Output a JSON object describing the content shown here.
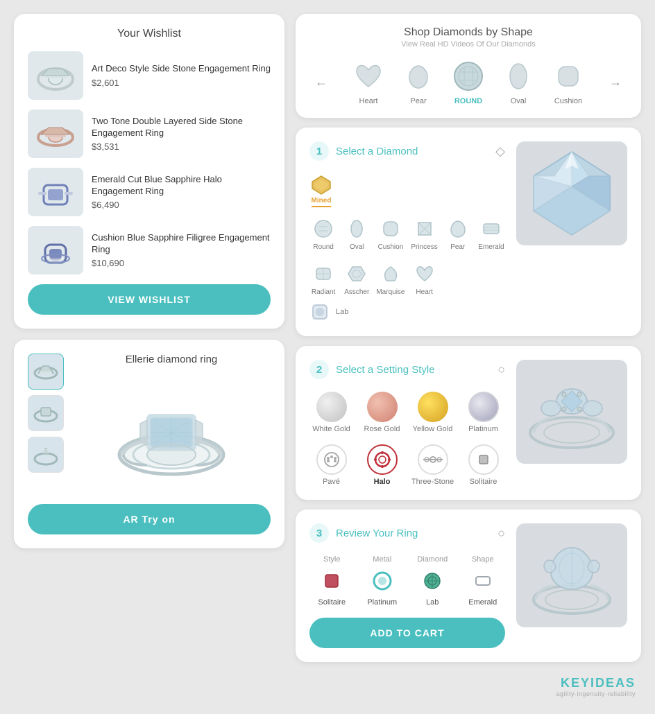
{
  "wishlist": {
    "title": "Your Wishlist",
    "items": [
      {
        "name": "Art Deco Style Side Stone Engagement Ring",
        "price": "$2,601",
        "color": "silver"
      },
      {
        "name": "Two Tone Double Layered Side Stone Engagement Ring",
        "price": "$3,531",
        "color": "rose"
      },
      {
        "name": "Emerald Cut Blue Sapphire Halo Engagement Ring",
        "price": "$6,490",
        "color": "blue"
      },
      {
        "name": "Cushion Blue Sapphire Filigree Engagement Ring",
        "price": "$10,690",
        "color": "blue2"
      }
    ],
    "btn_label": "VIEW WISHLIST"
  },
  "product": {
    "title": "Ellerie diamond ring",
    "btn_ar": "AR Try on"
  },
  "shape_shop": {
    "title": "Shop Diamonds by Shape",
    "subtitle": "View Real HD Videos Of Our Diamonds",
    "shapes": [
      "Heart",
      "Pear",
      "Round",
      "Oval",
      "Cushion"
    ],
    "active": "Round",
    "active_label": "ROUND"
  },
  "select_diamond": {
    "section_num": "1",
    "title": "Select a Diamond",
    "origin_options": [
      {
        "label": "Mined",
        "active": true
      },
      {
        "label": "Lab",
        "active": false
      }
    ],
    "shapes": [
      {
        "label": "Round",
        "active": false
      },
      {
        "label": "Oval",
        "active": false
      },
      {
        "label": "Cushion",
        "active": false
      },
      {
        "label": "Princess",
        "active": false
      },
      {
        "label": "Pear",
        "active": false
      },
      {
        "label": "Emerald",
        "active": false
      },
      {
        "label": "Radiant",
        "active": false
      },
      {
        "label": "Asscher",
        "active": false
      },
      {
        "label": "Marquise",
        "active": false
      },
      {
        "label": "Heart",
        "active": false
      }
    ]
  },
  "select_setting": {
    "section_num": "2",
    "title": "Select a Setting Style",
    "metals": [
      {
        "label": "White Gold",
        "type": "white-gold"
      },
      {
        "label": "Rose Gold",
        "type": "rose-gold"
      },
      {
        "label": "Yellow Gold",
        "type": "yellow-gold"
      },
      {
        "label": "Platinum",
        "type": "platinum"
      }
    ],
    "styles": [
      {
        "label": "Pavé",
        "active": false
      },
      {
        "label": "Halo",
        "active": true
      },
      {
        "label": "Three-Stone",
        "active": false
      },
      {
        "label": "Solitaire",
        "active": false
      }
    ]
  },
  "review": {
    "section_num": "3",
    "title": "Review Your Ring",
    "cols": [
      {
        "label": "Style",
        "value": "Solitaire",
        "icon": "◆"
      },
      {
        "label": "Metal",
        "value": "Platinum",
        "icon": "○"
      },
      {
        "label": "Diamond",
        "value": "Lab",
        "icon": "◎"
      },
      {
        "label": "Shape",
        "value": "Emerald",
        "icon": "⬡"
      }
    ],
    "btn_label": "ADD TO CART"
  },
  "brand": {
    "name": "KEYIDEAS",
    "tagline": "agility·ingenuity·reliability"
  }
}
